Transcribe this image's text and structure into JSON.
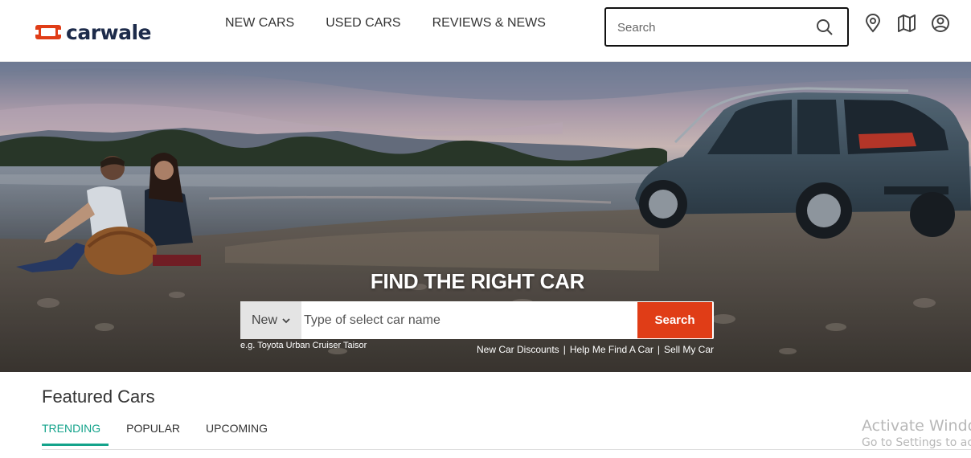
{
  "header": {
    "logo_text": "carwale",
    "nav": [
      "NEW CARS",
      "USED CARS",
      "REVIEWS & NEWS"
    ],
    "search_placeholder": "Search",
    "icons": [
      "search-icon",
      "location-pin-icon",
      "map-icon",
      "user-icon"
    ]
  },
  "hero": {
    "title": "FIND THE RIGHT CAR",
    "type_selected": "New",
    "car_input_placeholder": "Type of select car name",
    "search_button": "Search",
    "example": "e.g. Toyota Urban Cruiser Taisor",
    "quick_links": [
      "New Car Discounts",
      "Help Me Find A Car",
      "Sell My Car"
    ]
  },
  "featured": {
    "title": "Featured Cars",
    "tabs": [
      "TRENDING",
      "POPULAR",
      "UPCOMING"
    ],
    "active_tab": "TRENDING"
  },
  "watermark": {
    "line1": "Activate Windo",
    "line2": "Go to Settings to act"
  },
  "colors": {
    "brand": "#e03d17",
    "accent": "#14a38b",
    "logo_text": "#1d2b4a"
  }
}
